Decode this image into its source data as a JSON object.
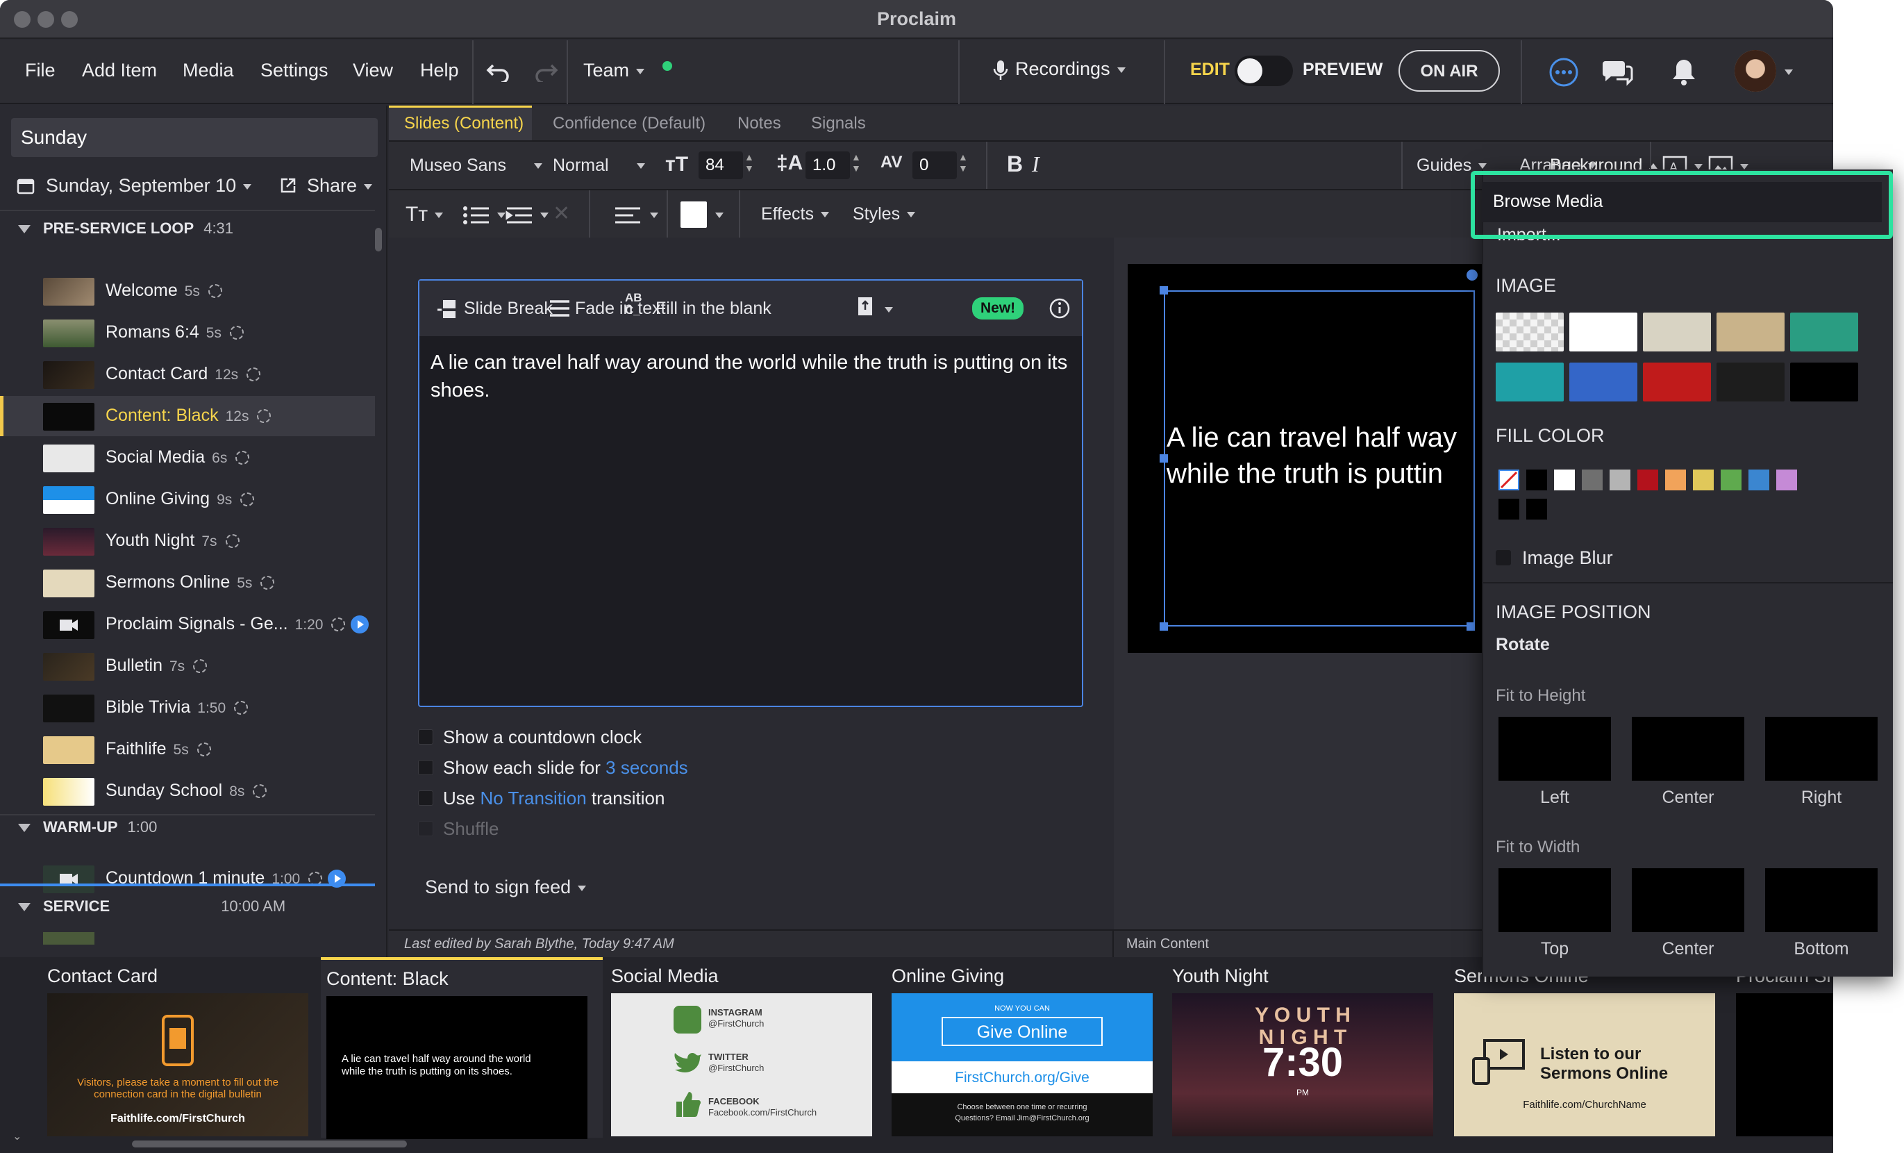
{
  "app": {
    "title": "Proclaim"
  },
  "menu": {
    "file": "File",
    "add_item": "Add Item",
    "media": "Media",
    "settings": "Settings",
    "view": "View",
    "help": "Help",
    "team": "Team",
    "recordings": "Recordings",
    "edit": "EDIT",
    "preview": "PREVIEW",
    "on_air": "ON AIR"
  },
  "sidebar": {
    "service_name": "Sunday",
    "date": "Sunday, September 10",
    "share": "Share",
    "sections": [
      {
        "title": "PRE-SERVICE LOOP",
        "duration": "4:31"
      },
      {
        "title": "WARM-UP",
        "duration": "1:00"
      },
      {
        "title": "SERVICE",
        "duration": "10:00 AM"
      }
    ],
    "items": [
      {
        "label": "Welcome",
        "dur": "5s"
      },
      {
        "label": "Romans 6:4",
        "dur": "5s"
      },
      {
        "label": "Contact Card",
        "dur": "12s"
      },
      {
        "label": "Content: Black",
        "dur": "12s"
      },
      {
        "label": "Social Media",
        "dur": "6s"
      },
      {
        "label": "Online Giving",
        "dur": "9s"
      },
      {
        "label": "Youth Night",
        "dur": "7s"
      },
      {
        "label": "Sermons Online",
        "dur": "5s"
      },
      {
        "label": "Proclaim Signals - Ge...",
        "dur": "1:20"
      },
      {
        "label": "Bulletin",
        "dur": "7s"
      },
      {
        "label": "Bible Trivia",
        "dur": "1:50"
      },
      {
        "label": "Faithlife",
        "dur": "5s"
      },
      {
        "label": "Sunday School",
        "dur": "8s"
      },
      {
        "label": "Countdown 1 minute",
        "dur": "1:00"
      }
    ]
  },
  "tabs": [
    "Slides (Content)",
    "Confidence (Default)",
    "Notes",
    "Signals"
  ],
  "toolbar": {
    "font": "Museo Sans",
    "weight": "Normal",
    "size": "84",
    "line_height": "1.0",
    "tracking": "0",
    "guides": "Guides",
    "arrange": "Arrange",
    "background": "Background",
    "effects": "Effects",
    "styles": "Styles"
  },
  "editor": {
    "slide_break": "Slide Break",
    "fade_in": "Fade in text",
    "fill_blank": "Fill in the blank",
    "new_badge": "New!",
    "text": "A lie can travel half way around the world while the truth is putting on its shoes."
  },
  "options": {
    "countdown": "Show a countdown clock",
    "show_each_pre": "Show each slide for",
    "show_each_val": "3 seconds",
    "use_pre": "Use",
    "transition_val": "No Transition",
    "use_post": "transition",
    "shuffle": "Shuffle",
    "sign_feed": "Send to sign feed"
  },
  "preview": {
    "slide_text_1": "A lie can travel half way",
    "slide_text_2": "while the truth is puttin"
  },
  "status": {
    "last_edited": "Last edited by Sarah Blythe, Today 9:47 AM",
    "main_content": "Main Content"
  },
  "bg_menu": {
    "browse": "Browse Media",
    "import": "Import...",
    "image": "IMAGE",
    "fill_color": "FILL COLOR",
    "image_blur": "Image Blur",
    "image_position": "IMAGE POSITION",
    "rotate": "Rotate",
    "fit_height": "Fit to Height",
    "fit_width": "Fit to Width",
    "left": "Left",
    "center": "Center",
    "right": "Right",
    "top": "Top",
    "center2": "Center",
    "bottom": "Bottom",
    "image_swatches": [
      "#e8e8e8",
      "#ffffff",
      "#d8d3c3",
      "#c9b38a",
      "#2a9d82",
      "#1fa0a6",
      "#3466c8",
      "#c01b1b",
      "#1d1d1d",
      "#000000"
    ],
    "fill_colors": [
      "none",
      "#000000",
      "#ffffff",
      "#6f6f6f",
      "#b4b4b4",
      "#b3121c",
      "#f1a35a",
      "#e0c85a",
      "#5faa4e",
      "#3b86d0",
      "#c58ad6",
      "#000000",
      "#000000"
    ]
  },
  "strip": {
    "cards": [
      {
        "title": "Contact Card",
        "t1": "Visitors, please take a moment to fill out the",
        "t2": "connection card in the digital bulletin",
        "t3": "Faithlife.com/FirstChurch"
      },
      {
        "title": "Content: Black",
        "t1": "A lie can travel half way around the world",
        "t2": "while the truth is putting on its shoes."
      },
      {
        "title": "Social Media",
        "t1": "INSTAGRAM",
        "t2": "@FirstChurch",
        "t3": "TWITTER",
        "t4": "@FirstChurch",
        "t5": "FACEBOOK",
        "t6": "Facebook.com/FirstChurch"
      },
      {
        "title": "Online Giving",
        "t1": "NOW YOU CAN",
        "t2": "Give Online",
        "t3": "FirstChurch.org/Give",
        "t4": "Choose between one time or recurring",
        "t5": "Questions? Email Jim@FirstChurch.org"
      },
      {
        "title": "Youth Night",
        "t1": "Y O U T H",
        "t2": "N I G H T",
        "t3": "7:30",
        "t4": "PM"
      },
      {
        "title": "Sermons Online",
        "t1": "Listen to our",
        "t2": "Sermons Online",
        "t3": "Faithlife.com/ChurchName"
      },
      {
        "title": "Proclaim Si"
      }
    ]
  },
  "colors": {
    "accent_yellow": "#f7d54c",
    "highlight_green": "#2de3a0",
    "link_blue": "#4a90e8",
    "new_green": "#2fd17a"
  }
}
